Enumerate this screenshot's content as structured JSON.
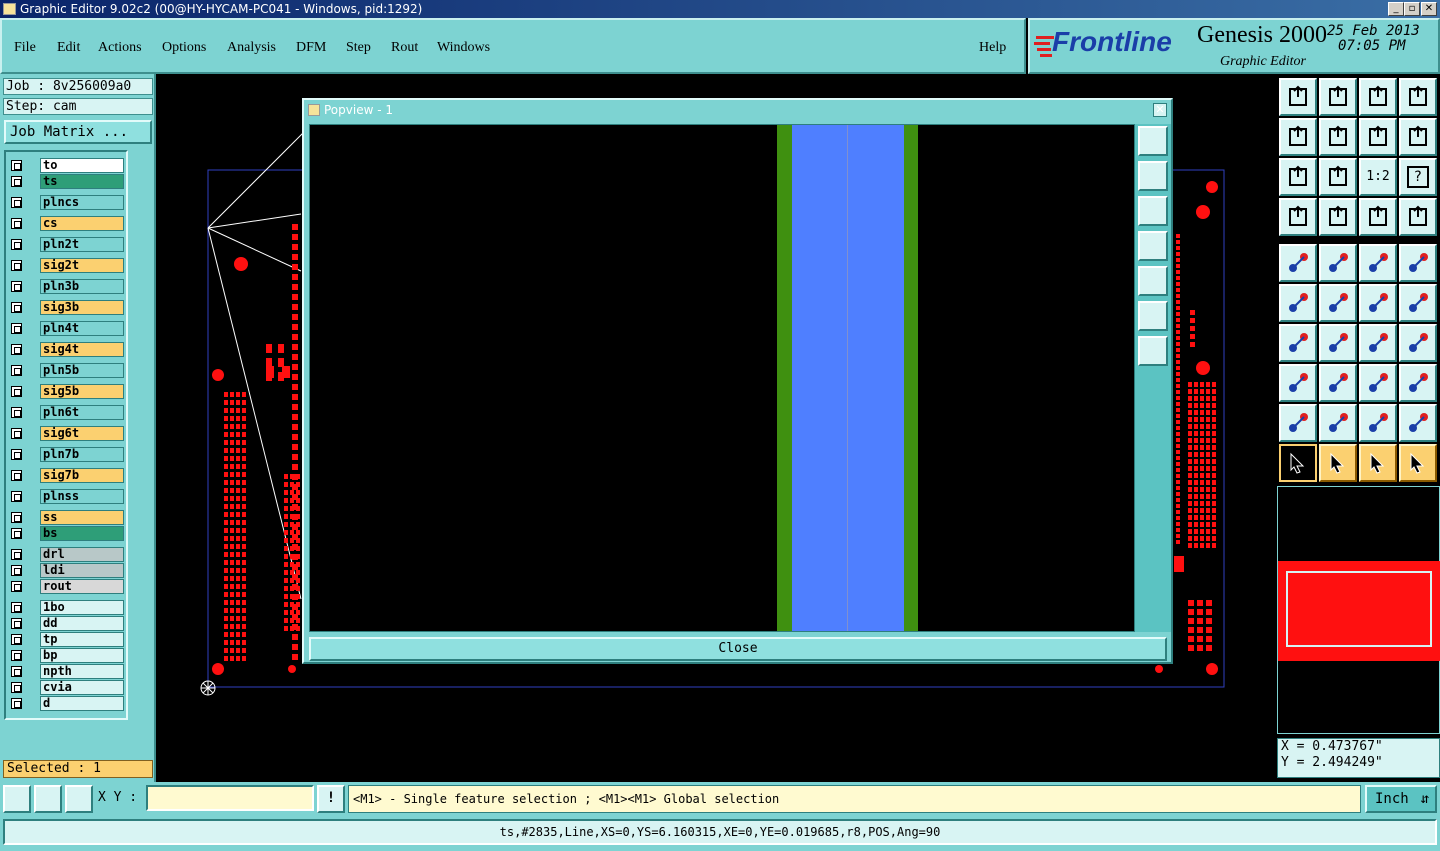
{
  "window": {
    "title": "Graphic Editor 9.02c2 (00@HY-HYCAM-PC041 - Windows, pid:1292)",
    "minimize": "_",
    "maximize": "▫",
    "close": "✕"
  },
  "menu": {
    "items": [
      "File",
      "Edit",
      "Actions",
      "Options",
      "Analysis",
      "DFM",
      "Step",
      "Rout",
      "Windows"
    ],
    "help": "Help"
  },
  "branding": {
    "logo": "Frontline",
    "product": "Genesis 2000",
    "subtitle": "Graphic Editor",
    "date": "25 Feb 2013",
    "time": "07:05 PM"
  },
  "job": {
    "job_line": "Job : 8v256009a0",
    "step_line": "Step: cam",
    "matrix_button": "Job Matrix ..."
  },
  "layers": [
    {
      "name": "to",
      "color": "#ffffff"
    },
    {
      "name": "ts",
      "color": "#2e9e78"
    },
    {
      "name": "plncs",
      "color": "#7dd3d2"
    },
    {
      "name": "cs",
      "color": "#fbd070"
    },
    {
      "name": "pln2t",
      "color": "#7dd3d2"
    },
    {
      "name": "sig2t",
      "color": "#fbd070"
    },
    {
      "name": "pln3b",
      "color": "#7dd3d2"
    },
    {
      "name": "sig3b",
      "color": "#fbd070"
    },
    {
      "name": "pln4t",
      "color": "#7dd3d2"
    },
    {
      "name": "sig4t",
      "color": "#fbd070"
    },
    {
      "name": "pln5b",
      "color": "#7dd3d2"
    },
    {
      "name": "sig5b",
      "color": "#fbd070"
    },
    {
      "name": "pln6t",
      "color": "#7dd3d2"
    },
    {
      "name": "sig6t",
      "color": "#fbd070"
    },
    {
      "name": "pln7b",
      "color": "#7dd3d2"
    },
    {
      "name": "sig7b",
      "color": "#fbd070"
    },
    {
      "name": "plnss",
      "color": "#7dd3d2"
    },
    {
      "name": "ss",
      "color": "#fbd070"
    },
    {
      "name": "bs",
      "color": "#2e9e78"
    },
    {
      "name": "drl",
      "color": "#b8c8c8"
    },
    {
      "name": "ldi",
      "color": "#b8c8c8"
    },
    {
      "name": "rout",
      "color": "#d8d8d8"
    },
    {
      "name": "1bo",
      "color": "#d8f4f3"
    },
    {
      "name": "dd",
      "color": "#d8f4f3"
    },
    {
      "name": "tp",
      "color": "#d8f4f3"
    },
    {
      "name": "bp",
      "color": "#d8f4f3"
    },
    {
      "name": "npth",
      "color": "#d8f4f3"
    },
    {
      "name": "cvia",
      "color": "#d8f4f3"
    },
    {
      "name": "d",
      "color": "#d8f4f3"
    }
  ],
  "selected_text": "Selected : 1",
  "popview": {
    "title": "Popview - 1",
    "close_label": "Close"
  },
  "coords": {
    "x": "X = 0.473767\"",
    "y": "Y = 2.494249\""
  },
  "bottom": {
    "xy_label": "X Y :",
    "xy_value": "",
    "message": "<M1> - Single feature selection ; <M1><M1> Global selection",
    "unit": "Inch",
    "bang": "!"
  },
  "status": "ts,#2835,Line,XS=0,YS=6.160315,XE=0,YE=0.019685,r8,POS,Ang=90",
  "toolbar_icons": {
    "scale_label": "1:2",
    "help_label": "?"
  }
}
